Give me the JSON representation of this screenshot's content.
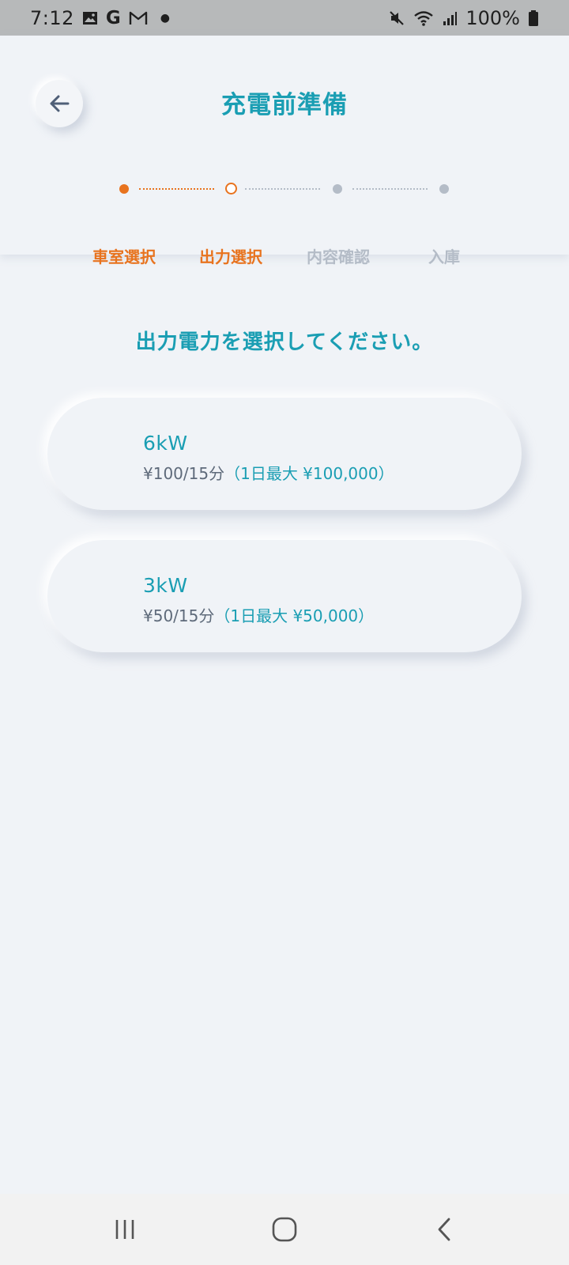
{
  "status_bar": {
    "time": "7:12",
    "notification_icons": [
      "gallery-icon",
      "google-icon",
      "gmail-icon",
      "dot-icon"
    ],
    "system_icons": [
      "mute-icon",
      "wifi-icon",
      "signal-icon",
      "battery-icon"
    ],
    "battery": "100%"
  },
  "header": {
    "title": "充電前準備",
    "back_icon": "arrow-left-icon"
  },
  "stepper": {
    "steps": [
      {
        "label": "車室選択",
        "state": "done"
      },
      {
        "label": "出力選択",
        "state": "current"
      },
      {
        "label": "内容確認",
        "state": "todo"
      },
      {
        "label": "入庫",
        "state": "todo"
      }
    ]
  },
  "prompt": "出力電力を選択してください。",
  "options": [
    {
      "power": "6kW",
      "price": "¥100/15分",
      "max": "（1日最大 ¥100,000）"
    },
    {
      "power": "3kW",
      "price": "¥50/15分",
      "max": "（1日最大 ¥50,000）"
    }
  ],
  "nav_bar": {
    "icons": [
      "recents-icon",
      "home-icon",
      "back-icon"
    ]
  },
  "colors": {
    "accent_teal": "#1a9eb3",
    "accent_orange": "#e8731e",
    "inactive_gray": "#b4bcc7",
    "background": "#f0f3f7"
  }
}
